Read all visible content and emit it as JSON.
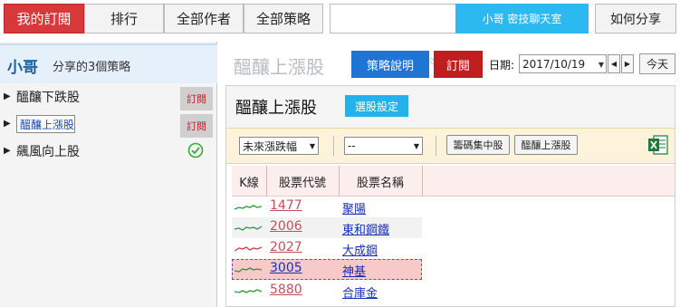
{
  "nav": {
    "tabs": [
      {
        "label": "我的訂閱",
        "active": true
      },
      {
        "label": "排行",
        "active": false
      },
      {
        "label": "全部作者",
        "active": false
      },
      {
        "label": "全部策略",
        "active": false
      }
    ],
    "chat_label": "小哥 密技聊天室",
    "share_label": "如何分享"
  },
  "sidebar": {
    "user_name": "小哥",
    "strategy_count_text": "分享的3個策略",
    "items": [
      {
        "label": "醞釀下跌股",
        "state": "subscribe",
        "badge": "訂閱"
      },
      {
        "label": "醞釀上漲股",
        "state": "subscribe",
        "badge": "訂閱",
        "selected": true
      },
      {
        "label": "飆風向上股",
        "state": "subscribed"
      }
    ]
  },
  "header": {
    "title": "醞釀上漲股",
    "explain_label": "策略說明",
    "small_mark": "♡",
    "subscribe_label": "訂閱",
    "date_label": "日期:",
    "date_value": "2017/10/19",
    "today_label": "今天"
  },
  "content": {
    "title": "醞釀上漲股",
    "select_label": "選股設定",
    "filter": {
      "select1": "未來漲跌幅",
      "select2": "--",
      "btn1": "籌碼集中股",
      "btn2": "醞釀上漲股"
    },
    "table": {
      "columns": [
        "K線",
        "股票代號",
        "股票名稱"
      ],
      "rows": [
        {
          "code": "1477",
          "name": "聚陽",
          "trend": "green"
        },
        {
          "code": "2006",
          "name": "東和鋼鐵",
          "trend": "green"
        },
        {
          "code": "2027",
          "name": "大成鋼",
          "trend": "red"
        },
        {
          "code": "3005",
          "name": "神基",
          "trend": "green"
        },
        {
          "code": "5880",
          "name": "合庫金",
          "trend": "green"
        }
      ]
    }
  },
  "colors": {
    "accent_red": "#d9383a",
    "accent_blue": "#1f74d4",
    "chat_cyan": "#2cb8f0",
    "link_blue": "#1a2eb8",
    "code_red": "#c0505a"
  }
}
